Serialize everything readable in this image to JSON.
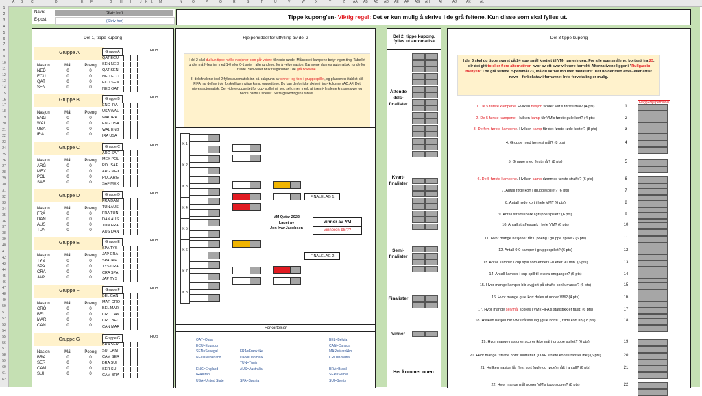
{
  "header": {
    "cols": [
      "A",
      "B",
      "C",
      "D",
      "E",
      "F",
      "G",
      "H",
      "I",
      "J",
      "K",
      "L",
      "M",
      "N",
      "O",
      "P",
      "Q",
      "R",
      "S",
      "T",
      "U",
      "V",
      "W",
      "X",
      "Y",
      "Z",
      "AA",
      "AB",
      "AC",
      "AD",
      "AE",
      "AF",
      "AG",
      "AH",
      "AI",
      "AJ",
      "AK",
      "AL"
    ],
    "name_label": "Navn:",
    "name_placeholder": "(Skriv her)",
    "email_label": "E-post:",
    "email_placeholder": "(Skriv her)",
    "title_main": "Tippe kupong'en-",
    "title_rule": "Viktig regel:",
    "title_rest": "Det er kun mulig å skrive i de grå feltene. Kun disse som skal fylles ut."
  },
  "part1": {
    "title": "Del 1, tippe kupong",
    "col_nasjon": "Nasjon",
    "col_mal": "Mål",
    "col_poeng": "Poeng",
    "hub": "HUB",
    "groups": [
      {
        "name": "Gruppe A",
        "short": "Gruppe A",
        "teams": [
          "NED",
          "ECU",
          "QAT",
          "SEN"
        ],
        "matches": [
          "QAT ECU",
          "SEN NED",
          "QAT SEN",
          "NED ECU",
          "ECU SEN",
          "NED QAT"
        ]
      },
      {
        "name": "Gruppe B",
        "short": "Gruppe B",
        "teams": [
          "ENG",
          "WAL",
          "USA",
          "IRA"
        ],
        "matches": [
          "ENG IRA",
          "USA WAL",
          "WAL IRA",
          "ENG USA",
          "WAL ENG",
          "IRA USA"
        ]
      },
      {
        "name": "Gruppe C",
        "short": "Gruppe C",
        "teams": [
          "ARG",
          "MEX",
          "POL",
          "SAF"
        ],
        "matches": [
          "ARG SAF",
          "MEX POL",
          "POL SAF",
          "ARG MEX",
          "POL ARG",
          "SAF MEX"
        ]
      },
      {
        "name": "Gruppe D",
        "short": "Gruppe D",
        "teams": [
          "FRA",
          "DAN",
          "AUS",
          "TUN"
        ],
        "matches": [
          "FRA DAN",
          "TUN AUS",
          "FRA TUN",
          "DAN AUS",
          "TUN FRA",
          "AUS DAN"
        ]
      },
      {
        "name": "Gruppe E",
        "short": "Gruppe E",
        "teams": [
          "TYS",
          "SPA",
          "CRA",
          "JAP"
        ],
        "matches": [
          "SPA TYS",
          "JAP CRA",
          "SPA JAP",
          "TYS CRA",
          "CRA SPA",
          "JAP TYS"
        ]
      },
      {
        "name": "Gruppe F",
        "short": "Gruppe F",
        "teams": [
          "CRO",
          "BEL",
          "MAR",
          "CAN"
        ],
        "matches": [
          "BEL CAN",
          "MAR CRO",
          "BEL MAR",
          "CRO CAN",
          "CRO BEL",
          "CAN MAR"
        ]
      },
      {
        "name": "Gruppe G",
        "short": "Gruppe G",
        "teams": [
          "BRA",
          "SER",
          "CAM",
          "SUI"
        ],
        "matches": [
          "BRA SER",
          "SUI CAM",
          "CAM SER",
          "BRA SUI",
          "SER SUI",
          "CAM BRA"
        ]
      }
    ],
    "zero": "0"
  },
  "helper": {
    "title": "Hjelpemiddel for utfylling av del 2",
    "note_p1a": "I del 2 skal ",
    "note_p1b": "du kun tippe hvilke nasjoner som går videre",
    "note_p1c": " til neste runde. Målscore i kampene betyr ingen ting. Tabellet under må fylles inn med 1-0 eller 0-1 seier i alle rundene, for å velge nasjon. Kampene dannes automatisk, runde for runde. Skriv eller bruk rullgardinen i de ",
    "note_p1d": "grå boksene.",
    "note_p2a": "8- delsfinalene i del 2 fylles automatisk inn på bakgrunn av ",
    "note_p2b": "vinner- og toer i gruppespillet",
    "note_p2c": ", og plasseres i tabllet slik FIFA har definert de forskjellige mulige kamp oppsettene. Du kan derfor ikke skrive i tips- kolonnen AD:AF. Det gjøres automatisk. Det videre oppsettet for cup- spillet gir seg selv, men merk at i semi- finalene krysses øvre og nedre halde i tabellet. Se farge kodingen i tabllet.",
    "k_labels": [
      "K 1",
      "K 2",
      "K 3",
      "K 4",
      "K 5",
      "K 6",
      "K 7",
      "K 8"
    ],
    "finale1": "FINALELAG 1",
    "finale2": "FINALELAG 2",
    "center1": "VM Qatar 2022",
    "center2": "Laget av",
    "center3": "Jon Ivar Jacobsen",
    "vinner": "Vinner av VM",
    "vinneren": "Vinneren blir??",
    "forkortelser": "Forkortelser",
    "abbr_col1": [
      "QAT=Qatar",
      "ECU=Equador",
      "SEN=Senegal",
      "NED=Nederland",
      "",
      "ENG=England",
      "IRA=Iran",
      "USA=United State"
    ],
    "abbr_col2": [
      "",
      "",
      "FRA=Frankrike",
      "DAN=Danmark",
      "TUN=Tunis",
      "AUS=Australia",
      "",
      "SPA=Spania"
    ],
    "abbr_col3": [
      "BEL=Belgia",
      "CAN=Canada",
      "MAR=Marokko",
      "CRO=Kroatia",
      "",
      "BRA=Brasil",
      "SER=Serbia",
      "SUI=Sveits"
    ]
  },
  "part2": {
    "title": "Del 2, tippe kupong, fylles ut automatisk",
    "attende": "Åttende dels- finalister",
    "kvart": "Kvart- finalister",
    "semi": "Semi- finalister",
    "finalister": "Finalister",
    "vinner": "Vinner",
    "her": "Her kommer noen"
  },
  "part3": {
    "title": "Del 3 tippe kupong",
    "intro_a": "I del 3 skal du tippe svaret på 24 spørsmål knyttet til VM- turneringen. For alle spørsmålene, bortsett fra ",
    "intro_b": "23",
    "intro_c": ", blir det gitt ",
    "intro_d": "to eller flere alternativer",
    "intro_e": ", hvor av ett svar vil være korrekt. Alternativene ligger i \"",
    "intro_f": "Rullgardin menyen",
    "intro_g": "\" i de grå feltene.  Spørsmål 23, må du skrive inn med tastaturet. Det holder med etter- eller artist navn + forbokstav i fornavnet hvis forveksling er mulig.",
    "flag": "Flagg+Hjelpemiddel",
    "questions": [
      {
        "n": "1",
        "red": "1. De 5 første kampene",
        "a": ".  Hvilken ",
        "b": "nasjon",
        "c": " scorer VM's første mål? (4 pts)"
      },
      {
        "n": "2",
        "red": "2. De 5 første kampene",
        "a": ".  Hvilken ",
        "b": "kamp",
        "c": " får VM's første gule kort? (4 pts)"
      },
      {
        "n": "3",
        "red": "3. De fem første kampene",
        "a": ". Hvilken ",
        "b": "kamp",
        "c": " får det første røde kortet? (8 pts)"
      },
      {
        "n": "4",
        "red": "",
        "a": "4. Gruppe med færrest mål? (8 pts)",
        "b": "",
        "c": ""
      },
      {
        "n": "5",
        "red": "",
        "a": "5. Gruppe med flest mål? (8 pts)",
        "b": "",
        "c": ""
      },
      {
        "n": "6",
        "red": "6. De 5 første kampene",
        "a": ". Hvilken ",
        "b": "kamp",
        "c": " dømmes første straffe? (6 pts)"
      },
      {
        "n": "7",
        "red": "",
        "a": "7. Antall røde kort i gruppespillet? (6 pts)",
        "b": "",
        "c": ""
      },
      {
        "n": "8",
        "red": "",
        "a": "8. Antall røde kort i hele VM? (6 pts)",
        "b": "",
        "c": ""
      },
      {
        "n": "9",
        "red": "",
        "a": "9. Antall straffespark i gruppe spillet? (6 pts)",
        "b": "",
        "c": ""
      },
      {
        "n": "10",
        "red": "",
        "a": "10. Antall straffespark i hele VM? (6 pts)",
        "b": "",
        "c": ""
      },
      {
        "n": "11",
        "red": "",
        "a": "11. Hvor mange nasjoner får 0 poeng i gruppe spillet? (6 pts)",
        "b": "",
        "c": ""
      },
      {
        "n": "12",
        "red": "",
        "a": "12. Antall 0-0 kamper i gruppespillet? (6 pts)",
        "b": "",
        "c": ""
      },
      {
        "n": "13",
        "red": "",
        "a": "13. Antall kamper i cup spill som ender 0-0 etter 90 min. (6 pts)",
        "b": "",
        "c": ""
      },
      {
        "n": "14",
        "red": "",
        "a": "14. Antall kamper i cup spill til ekstra omganger? (6 pts)",
        "b": "",
        "c": ""
      },
      {
        "n": "15",
        "red": "",
        "a": "15. Hvor mange kamper blir avgjort på straffe konkurranse? (6 pts)",
        "b": "",
        "c": ""
      },
      {
        "n": "16",
        "red": "",
        "a": "16. Hvor mange gule kort deles ut under VM? (4 pts)",
        "b": "",
        "c": ""
      },
      {
        "n": "17",
        "red": "",
        "a": "17. Hvor mange ",
        "b": "selvmål",
        "c": " scores i VM (FIFA's statistikk er fasit) (6 pts)"
      },
      {
        "n": "18",
        "red": "",
        "a": "18. Hvilken nasjon blir VM's råtass lag (gule kort=1, røde kort =3)( 8 pts)",
        "b": "",
        "c": ""
      },
      {
        "n": "19",
        "red": "",
        "a": "19. Hvor mange nasjoner scorer ikke mål i gruppe spillet? (6 pts)",
        "b": "",
        "c": ""
      },
      {
        "n": "20",
        "red": "",
        "a": "20. Hvor mange \"straffe bom\" inntreffer. (IKKE straffe konkurranser inkl) (6 pts)",
        "b": "",
        "c": ""
      },
      {
        "n": "21",
        "red": "",
        "a": "21. Hvilken nasjon får flest kort (gule og røde) målt i antall? (6 pts)",
        "b": "",
        "c": ""
      },
      {
        "n": "22",
        "red": "",
        "a": "22. Hvor mange mål scorer VM's topp scorer? (8 pts)",
        "b": "",
        "c": ""
      }
    ]
  }
}
